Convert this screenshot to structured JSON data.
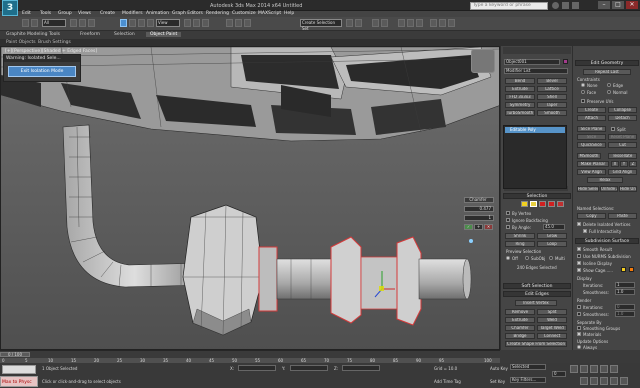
{
  "window": {
    "title": "Autodesk 3ds Max 2014 x64   Untitled",
    "logo": "3"
  },
  "search": {
    "placeholder": "Type a keyword or phrase"
  },
  "window_controls": [
    "–",
    "□",
    "✕"
  ],
  "menu": [
    "Edit",
    "Tools",
    "Group",
    "Views",
    "Create",
    "Modifiers",
    "Animation",
    "Graph Editors",
    "Rendering",
    "Customize",
    "MAXScript",
    "Help"
  ],
  "toolbar": {
    "selection_set": "All",
    "view_dropdown": "View",
    "named_set": "Create Selection Set"
  },
  "ribbon": {
    "tabs": [
      "Graphite Modeling Tools",
      "Freeform",
      "Selection",
      "Object Paint"
    ],
    "active": "Object Paint",
    "sub": [
      "Paint Objects",
      "Brush Settings"
    ]
  },
  "viewport": {
    "label": "[+][Perspective][Shaded + Edged Faces]"
  },
  "warning": {
    "title": "Warning: Isolated Sele...",
    "exit_label": "Exit Isolation Mode"
  },
  "chamfer": {
    "title": "Chamfer",
    "amount": "0.477",
    "segments": "1",
    "ok": "✓",
    "apply": "+",
    "cancel": "✕"
  },
  "modifier_panel": {
    "object_name": "Object001",
    "modifier_list": "Modifier List",
    "buttons": [
      [
        "Bend",
        "Bevel"
      ],
      [
        "Extrude",
        "Lattice"
      ],
      [
        "FFD 3x3x3",
        "Shell"
      ],
      [
        "Symmetry",
        "Taper"
      ],
      [
        "TurboSmooth",
        "Smooth"
      ]
    ],
    "stack_item": "Editable Poly"
  },
  "selection": {
    "header": "Selection",
    "by_vertex": "By Vertex",
    "ignore_backfacing": "Ignore Backfacing",
    "by_angle": "By Angle:",
    "angle": "45.0",
    "shrink": "Shrink",
    "grow": "Grow",
    "ring": "Ring",
    "loop": "Loop",
    "preview": "Preview Selection",
    "preview_opts": [
      "Off",
      "SubObj",
      "Multi"
    ],
    "status": "240 Edges Selected"
  },
  "soft_selection": {
    "header": "Soft Selection"
  },
  "edit_edges": {
    "header": "Edit Edges",
    "insert": "Insert Vertex",
    "rows": [
      [
        "Remove",
        "Split"
      ],
      [
        "Extrude",
        "Weld"
      ],
      [
        "Chamfer",
        "Target Weld"
      ],
      [
        "Bridge",
        "Connect"
      ]
    ],
    "shape": "Create Shape From Selection",
    "weight_label": "Weight:",
    "weight": "1.0",
    "crease_label": "Crease:",
    "crease": "0.0"
  },
  "edit_geometry": {
    "header": "Edit Geometry",
    "repeat": "Repeat Last",
    "constraints": "Constraints",
    "constraint_opts": [
      [
        "None",
        "Edge"
      ],
      [
        "Face",
        "Normal"
      ]
    ],
    "preserve": "Preserve UVs",
    "rows": [
      [
        "Create",
        "Collapse"
      ],
      [
        "Attach",
        "Detach"
      ]
    ],
    "slice_plane": "Slice Plane",
    "split": "Split",
    "slice": "Slice",
    "reset_plane": "Reset Plane",
    "quickslice": "QuickSlice",
    "cut": "Cut",
    "msmooth": "MSmooth",
    "tessellate": "Tessellate",
    "make_planar": "Make Planar",
    "axes": [
      "X",
      "Y",
      "Z"
    ],
    "view_align": "View Align",
    "grid_align": "Grid Align",
    "relax": "Relax",
    "hide": [
      "Hide Selected",
      "Unhide All",
      "Hide Unselected"
    ],
    "named": "Named Selections:",
    "copy": "Copy",
    "paste": "Paste",
    "delete_isolated": "Delete Isolated Vertices",
    "full_interactivity": "Full Interactivity"
  },
  "subdivision": {
    "header": "Subdivision Surface",
    "smooth_result": "Smooth Result",
    "nurms": "Use NURMS Subdivision",
    "isoline": "Isoline Display",
    "show_cage": "Show Cage......",
    "display": "Display",
    "iterations_label": "Iterations:",
    "iterations": "1",
    "smoothness_label": "Smoothness:",
    "smoothness": "1.0",
    "render": "Render",
    "render_iter": "0",
    "render_smooth": "1.0",
    "separate_by": "Separate By",
    "smoothing_groups": "Smoothing Groups",
    "materials": "Materials",
    "update": "Update Options",
    "update_opts": [
      "Always",
      "When Rendering",
      "Manually"
    ]
  },
  "colors": {
    "cage1": "#f5d020",
    "cage2": "#f57a0a",
    "accent": "#5794c9"
  },
  "timeline": {
    "frame": "0 / 100",
    "ticks": [
      "0",
      "5",
      "10",
      "15",
      "20",
      "25",
      "30",
      "35",
      "40",
      "45",
      "50",
      "55",
      "60",
      "65",
      "70",
      "75",
      "80",
      "85",
      "90",
      "95",
      "100"
    ]
  },
  "status": {
    "selected": "1 Object Selected",
    "prompt": "Click or click-and-drag to select objects",
    "maxscript": "Max to Physc",
    "x_label": "X:",
    "x": "",
    "y_label": "Y:",
    "y": "",
    "z_label": "Z:",
    "z": "",
    "grid": "Grid = 10.0",
    "add_time_tag": "Add Time Tag",
    "auto_key": "Auto Key",
    "selected_drop": "Selected",
    "set_key": "Set Key",
    "key_filters": "Key Filters...",
    "frame": "0"
  }
}
